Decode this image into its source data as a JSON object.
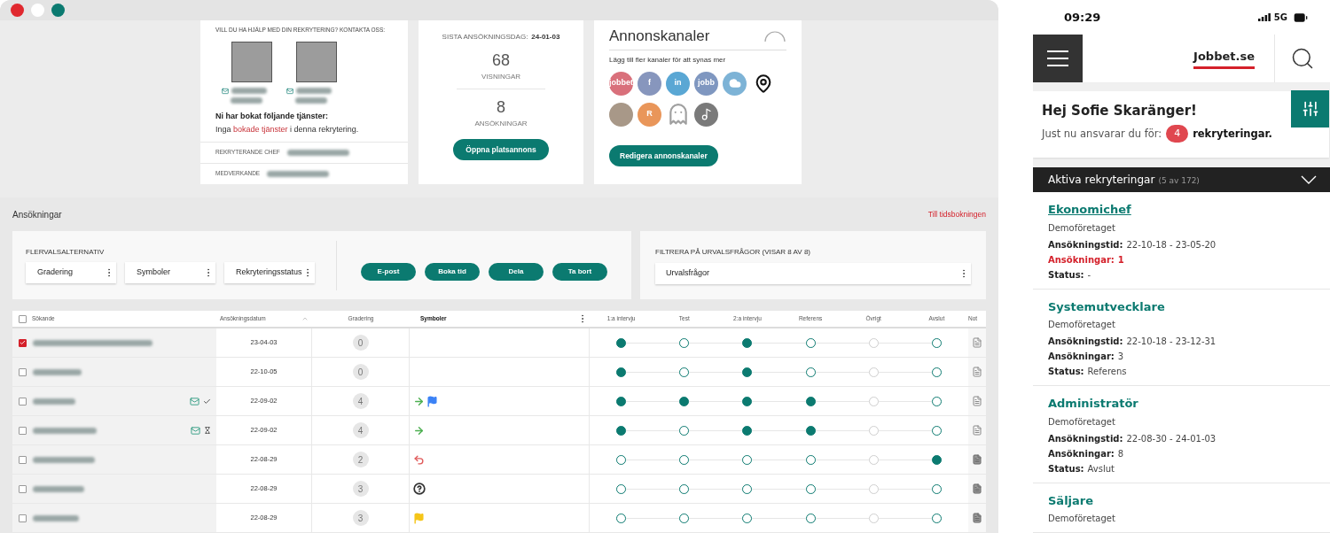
{
  "contact_card": {
    "heading": "VILL DU HA HJÄLP MED DIN REKRYTERING? KONTAKTA OSS:",
    "services_heading": "Ni har bokat följande tjänster:",
    "services_text": {
      "before": "Inga",
      "link": "bokade tjänster",
      "after": "i denna rekrytering."
    },
    "roles": [
      {
        "label": "REKRYTERANDE CHEF"
      },
      {
        "label": "MEDVERKANDE"
      }
    ]
  },
  "stats_card": {
    "deadline_label": "SISTA ANSÖKNINGSDAG:",
    "deadline": "24-01-03",
    "stats": [
      {
        "value": "68",
        "label": "VISNINGAR"
      },
      {
        "value": "8",
        "label": "ANSÖKNINGAR"
      }
    ],
    "button": "Öppna platsannons"
  },
  "channels_card": {
    "title": "Annonskanaler",
    "hint": "Lägg till fler kanaler för att synas mer",
    "button": "Redigera annonskanaler",
    "channels": [
      {
        "kind": "text",
        "label": "jobbet",
        "color": "#d9707b"
      },
      {
        "kind": "text",
        "label": "f",
        "color": "#8796bd"
      },
      {
        "kind": "text",
        "label": "in",
        "color": "#5aa7d4"
      },
      {
        "kind": "text",
        "label": "jobb",
        "color": "#7f97c0"
      },
      {
        "kind": "cloud",
        "color": "#7db3d6"
      },
      {
        "kind": "pin",
        "color": "#111111"
      },
      {
        "kind": "photo",
        "color": "#a89888"
      },
      {
        "kind": "text",
        "label": "R",
        "color": "#e9965a"
      },
      {
        "kind": "ghost",
        "color": "#a0a0a0"
      },
      {
        "kind": "note",
        "color": "#7a7a7a"
      }
    ]
  },
  "applications": {
    "title": "Ansökningar",
    "link": "Till tidsbokningen",
    "multi_label": "FLERVALSALTERNATIV",
    "dropdowns": [
      "Gradering",
      "Symboler",
      "Rekryteringsstatus"
    ],
    "actions": [
      "E-post",
      "Boka tid",
      "Dela",
      "Ta bort"
    ],
    "filter_label": "FILTRERA PÅ URVALSFRÅGOR (VISAR 8 AV 8)",
    "filter_dropdown": "Urvalsfrågor"
  },
  "table": {
    "select_all_checked": false,
    "columns": [
      "Sökande",
      "Ansökningsdatum",
      "Gradering",
      "Symboler",
      "1:a intervju",
      "Test",
      "2:a intervju",
      "Referens",
      "Övrigt",
      "Avslut",
      "Not"
    ],
    "rows": [
      {
        "checked": true,
        "indicators": [],
        "date": "23-04-03",
        "grade": "0",
        "symbols": [],
        "stages": [
          {
            "done": true,
            "enabled": true
          },
          {
            "done": false,
            "enabled": true
          },
          {
            "done": true,
            "enabled": true
          },
          {
            "done": false,
            "enabled": true
          },
          {
            "done": false,
            "enabled": false
          },
          {
            "done": false,
            "enabled": true
          }
        ],
        "note_written": false
      },
      {
        "checked": false,
        "indicators": [],
        "date": "22-10-05",
        "grade": "0",
        "symbols": [],
        "stages": [
          {
            "done": true,
            "enabled": true
          },
          {
            "done": false,
            "enabled": true
          },
          {
            "done": true,
            "enabled": true
          },
          {
            "done": false,
            "enabled": true
          },
          {
            "done": false,
            "enabled": false
          },
          {
            "done": false,
            "enabled": true
          }
        ],
        "note_written": false
      },
      {
        "checked": false,
        "indicators": [
          {
            "kind": "mail"
          },
          {
            "kind": "check"
          }
        ],
        "date": "22-09-02",
        "grade": "4",
        "symbols": [
          {
            "kind": "arrow",
            "color": "#4caf50"
          },
          {
            "kind": "flag",
            "color": "#3b82f6"
          }
        ],
        "stages": [
          {
            "done": true,
            "enabled": true
          },
          {
            "done": true,
            "enabled": true
          },
          {
            "done": true,
            "enabled": true
          },
          {
            "done": true,
            "enabled": true
          },
          {
            "done": false,
            "enabled": false
          },
          {
            "done": false,
            "enabled": true
          }
        ],
        "note_written": false
      },
      {
        "checked": false,
        "indicators": [
          {
            "kind": "mail"
          },
          {
            "kind": "hourglass"
          }
        ],
        "date": "22-09-02",
        "grade": "4",
        "symbols": [
          {
            "kind": "arrow",
            "color": "#4caf50"
          }
        ],
        "stages": [
          {
            "done": true,
            "enabled": true
          },
          {
            "done": false,
            "enabled": true
          },
          {
            "done": true,
            "enabled": true
          },
          {
            "done": true,
            "enabled": true
          },
          {
            "done": false,
            "enabled": false
          },
          {
            "done": false,
            "enabled": true
          }
        ],
        "note_written": false
      },
      {
        "checked": false,
        "indicators": [],
        "date": "22-08-29",
        "grade": "2",
        "symbols": [
          {
            "kind": "undo",
            "color": "#e05a5a"
          }
        ],
        "stages": [
          {
            "done": false,
            "enabled": true
          },
          {
            "done": false,
            "enabled": true
          },
          {
            "done": false,
            "enabled": true
          },
          {
            "done": false,
            "enabled": true
          },
          {
            "done": false,
            "enabled": false
          },
          {
            "done": true,
            "enabled": true
          }
        ],
        "note_written": true
      },
      {
        "checked": false,
        "indicators": [],
        "date": "22-08-29",
        "grade": "3",
        "symbols": [
          {
            "kind": "question",
            "color": "#333333"
          }
        ],
        "stages": [
          {
            "done": false,
            "enabled": true
          },
          {
            "done": false,
            "enabled": true
          },
          {
            "done": false,
            "enabled": true
          },
          {
            "done": false,
            "enabled": true
          },
          {
            "done": false,
            "enabled": false
          },
          {
            "done": false,
            "enabled": true
          }
        ],
        "note_written": true
      },
      {
        "checked": false,
        "indicators": [],
        "date": "22-08-29",
        "grade": "3",
        "symbols": [
          {
            "kind": "flag",
            "color": "#f5c518"
          }
        ],
        "stages": [
          {
            "done": false,
            "enabled": true
          },
          {
            "done": false,
            "enabled": true
          },
          {
            "done": false,
            "enabled": true
          },
          {
            "done": false,
            "enabled": true
          },
          {
            "done": false,
            "enabled": false
          },
          {
            "done": false,
            "enabled": true
          }
        ],
        "note_written": true
      }
    ]
  },
  "phone": {
    "time": "09:29",
    "network": "5G",
    "logo": "Jobbet.se",
    "greeting": "Hej Sofie Skaränger!",
    "responsible_text": "Just nu ansvarar du för:",
    "count": "4",
    "count_suffix": "rekryteringar.",
    "list_title": "Aktiva rekryteringar",
    "list_count": "(5 av 172)",
    "items": [
      {
        "title": "Ekonomichef",
        "selected": true,
        "company": "Demoföretaget",
        "fields": [
          {
            "label": "Ansökningstid:",
            "value": "22-10-18 - 23-05-20",
            "alert": false
          },
          {
            "label": "Ansökningar:",
            "value": "1",
            "alert": true
          },
          {
            "label": "Status:",
            "value": "-",
            "alert": false
          }
        ]
      },
      {
        "title": "Systemutvecklare",
        "selected": false,
        "company": "Demoföretaget",
        "fields": [
          {
            "label": "Ansökningstid:",
            "value": "22-10-18 - 23-12-31",
            "alert": false
          },
          {
            "label": "Ansökningar:",
            "value": "3",
            "alert": false
          },
          {
            "label": "Status:",
            "value": "Referens",
            "alert": false
          }
        ]
      },
      {
        "title": "Administratör",
        "selected": false,
        "company": "Demoföretaget",
        "fields": [
          {
            "label": "Ansökningstid:",
            "value": "22-08-30 - 24-01-03",
            "alert": false
          },
          {
            "label": "Ansökningar:",
            "value": "8",
            "alert": false
          },
          {
            "label": "Status:",
            "value": "Avslut",
            "alert": false
          }
        ]
      },
      {
        "title": "Säljare",
        "selected": false,
        "company": "Demoföretaget"
      }
    ]
  }
}
